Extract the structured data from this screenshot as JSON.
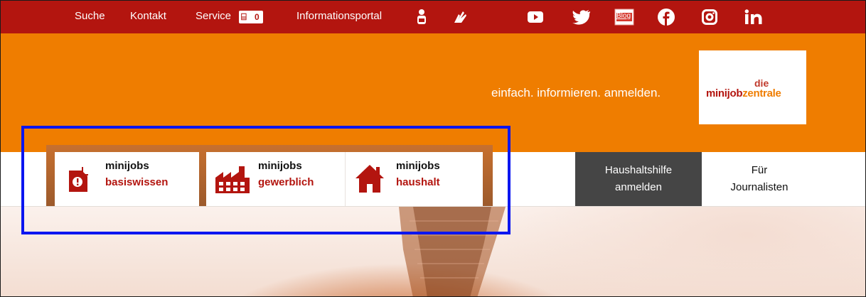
{
  "topbar": {
    "links": {
      "suche": "Suche",
      "kontakt": "Kontakt",
      "service": "Service",
      "service_count": "0",
      "infoportal": "Informationsportal"
    },
    "blog_label": "Blog",
    "icons": [
      "easy-language-icon",
      "sign-language-icon",
      "youtube-icon",
      "twitter-icon",
      "blog-icon",
      "facebook-icon",
      "instagram-icon",
      "linkedin-icon"
    ]
  },
  "header": {
    "slogan": "einfach. informieren. anmelden.",
    "logo": {
      "die": "die",
      "minijob": "minijob",
      "zentrale": "zentrale"
    }
  },
  "nav": {
    "tabs": [
      {
        "line1": "minijobs",
        "line2": "basiswissen",
        "icon": "document-alert-icon"
      },
      {
        "line1": "minijobs",
        "line2": "gewerblich",
        "icon": "factory-icon"
      },
      {
        "line1": "minijobs",
        "line2": "haushalt",
        "icon": "house-icon"
      }
    ],
    "haushaltshilfe": {
      "line1": "Haushaltshilfe",
      "line2": "anmelden"
    },
    "journalisten": {
      "line1": "Für",
      "line2": "Journalisten"
    }
  },
  "colors": {
    "topbar": "#b3150f",
    "header": "#ef7d00",
    "accent_red": "#b3150f",
    "dark_button": "#454545",
    "highlight": "#0b16f0"
  }
}
